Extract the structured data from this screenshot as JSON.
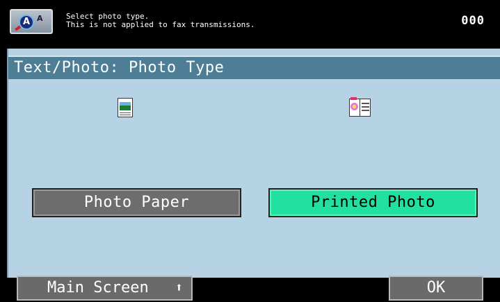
{
  "topbar": {
    "message_line1": "Select photo type.",
    "message_line2": "This is not applied to fax transmissions.",
    "counter": "000",
    "help_icon": "help-pen-icon"
  },
  "dialog": {
    "title": "Text/Photo: Photo Type"
  },
  "options": [
    {
      "label": "Photo Paper",
      "icon": "photo-paper-icon",
      "selected": false
    },
    {
      "label": "Printed Photo",
      "icon": "printed-photo-icon",
      "selected": true
    }
  ],
  "footer": {
    "main_screen_label": "Main Screen",
    "main_screen_icon": "up-arrow-icon",
    "ok_label": "OK"
  },
  "colors": {
    "title_bar": "#4d7e96",
    "panel_bg": "#b5d3e4",
    "selected_button": "#21e0a0",
    "unselected_button": "#6d6d6d"
  }
}
